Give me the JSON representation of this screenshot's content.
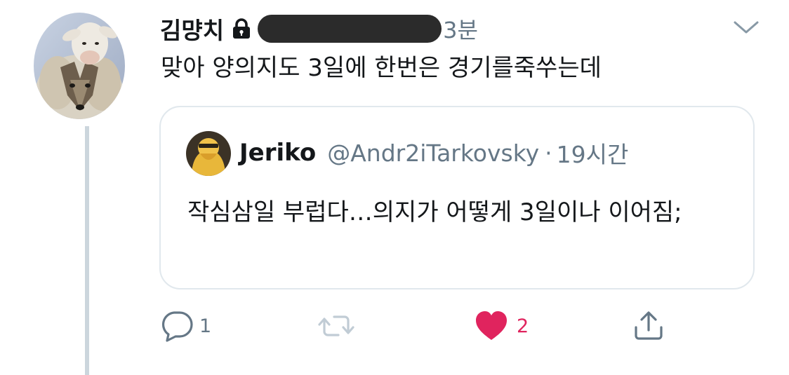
{
  "tweet": {
    "display_name": "김먕치",
    "timestamp": "3분",
    "text": "맞아 양의지도 3일에 한번은 경기를죽쑤는데",
    "icons": {
      "lock": "lock-icon",
      "caret": "chevron-down-icon",
      "handle": "redacted-handle"
    }
  },
  "quote": {
    "display_name": "Jeriko",
    "handle": "@Andr2iTarkovsky",
    "separator": "·",
    "timestamp": "19시간",
    "text": "작심삼일 부럽다…의지가 어떻게 3일이나 이어짐;"
  },
  "actions": {
    "reply": {
      "icon": "reply-icon",
      "count": "1"
    },
    "retweet": {
      "icon": "retweet-icon",
      "count": ""
    },
    "like": {
      "icon": "heart-icon",
      "count": "2",
      "liked": true
    },
    "share": {
      "icon": "share-icon"
    }
  },
  "colors": {
    "text_primary": "#14171a",
    "text_secondary": "#657786",
    "border": "#e1e8ed",
    "thread_line": "#ccd6dd",
    "like": "#e0245e"
  }
}
